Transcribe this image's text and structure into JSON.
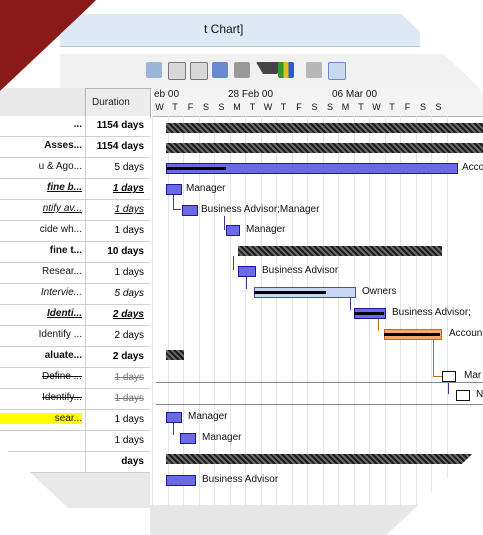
{
  "window": {
    "title_fragment": "t Chart]"
  },
  "toolbar": {
    "icons": [
      "zoom-icon",
      "copy-icon",
      "paste-icon",
      "link-icon",
      "find-icon",
      "filter-icon",
      "chart-icon",
      "print-icon",
      "preview-icon"
    ]
  },
  "table": {
    "duration_header": "Duration",
    "rows": [
      {
        "name": "...",
        "duration": "1154 days",
        "style": "bold"
      },
      {
        "name": "Asses...",
        "duration": "1154 days",
        "style": "bold"
      },
      {
        "name": "u & Ago...",
        "duration": "5 days",
        "style": "normal"
      },
      {
        "name": "fine b...",
        "duration": "1 days",
        "style": "bold-italic-underline"
      },
      {
        "name": "ntify av...",
        "duration": "1 days",
        "style": "italic-underline"
      },
      {
        "name": "cide wh...",
        "duration": "1 days",
        "style": "normal"
      },
      {
        "name": "fine t...",
        "duration": "10 days",
        "style": "bold"
      },
      {
        "name": "Resear...",
        "duration": "1 days",
        "style": "normal"
      },
      {
        "name": "Intervie...",
        "duration": "5 days",
        "style": "italic"
      },
      {
        "name": "Identi...",
        "duration": "2 days",
        "style": "bold-italic-underline"
      },
      {
        "name": "Identify ...",
        "duration": "2 days",
        "style": "normal"
      },
      {
        "name": "aluate...",
        "duration": "2 days",
        "style": "bold"
      },
      {
        "name": "Define ...",
        "duration": "1 days",
        "style": "strike"
      },
      {
        "name": "Identify...",
        "duration": "1 days",
        "style": "strike"
      },
      {
        "name": "sear...",
        "duration": "1 days",
        "style": "highlight"
      },
      {
        "name": "",
        "duration": "1 days",
        "style": "normal"
      },
      {
        "name": "",
        "duration": "days",
        "style": "bold"
      }
    ]
  },
  "timeline": {
    "weeks": [
      "eb 00",
      "28 Feb 00",
      "06 Mar 00"
    ],
    "days": [
      "W",
      "T",
      "F",
      "S",
      "S",
      "M",
      "T",
      "W",
      "T",
      "F",
      "S",
      "S",
      "M",
      "T",
      "W",
      "T",
      "F",
      "S",
      "S"
    ]
  },
  "gantt_labels": {
    "acc1": "Acco",
    "manager1": "Manager",
    "ba_manager": "Business Advisor;Manager",
    "manager2": "Manager",
    "ba1": "Business Advisor",
    "owners": "Owners",
    "ba2": "Business Advisor;",
    "acc2": "Accoun",
    "mar": "Mar",
    "n": "N",
    "manager3": "Manager",
    "manager4": "Manager",
    "ba3": "Business Advisor"
  }
}
